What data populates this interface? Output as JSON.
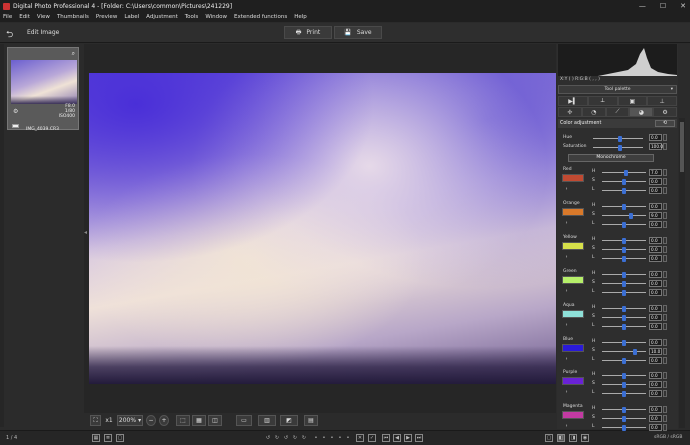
{
  "window": {
    "title": "Digital Photo Professional 4 - [Folder: C:\\Users\\common\\Pictures\\241229]",
    "min": "—",
    "max": "☐",
    "close": "✕"
  },
  "menu": [
    "File",
    "Edit",
    "View",
    "Thumbnails",
    "Preview",
    "Label",
    "Adjustment",
    "Tools",
    "Window",
    "Extended functions",
    "Help"
  ],
  "toolbar": {
    "edit_label": "Edit Image",
    "print_label": "Print",
    "save_label": "Save"
  },
  "thumbnail": {
    "exposure": "F8.0",
    "shutter": "1/80",
    "iso": "ISO400",
    "name": "IMG_4039.CR3"
  },
  "viewer": {
    "zoom": "200%",
    "fit": "x1"
  },
  "status": {
    "page": "1 / 4",
    "colorspace": "sRGB / sRGB"
  },
  "panel": {
    "rgb_line": "X:Y (     )   R:G:B (     ,     ,     )",
    "tool_palette": "Tool palette",
    "color_adjustment": "Color adjustment",
    "monochrome": "Monochrome"
  },
  "color_adjust": {
    "hue_label": "Hue",
    "hue_value": "0.0",
    "saturation_label": "Saturation",
    "saturation_value": "100.0"
  },
  "groups": [
    {
      "name": "Red",
      "color": "#c04a32",
      "h": "7.0",
      "s": "0.0",
      "l": "0.0"
    },
    {
      "name": "Orange",
      "color": "#d9792a",
      "h": "0.0",
      "s": "9.0",
      "l": "0.0"
    },
    {
      "name": "Yellow",
      "color": "#d6e04a",
      "h": "0.0",
      "s": "0.0",
      "l": "0.0"
    },
    {
      "name": "Green",
      "color": "#b6ef6a",
      "h": "0.0",
      "s": "0.0",
      "l": "0.0"
    },
    {
      "name": "Aqua",
      "color": "#8ee0d8",
      "h": "0.0",
      "s": "0.0",
      "l": "0.0"
    },
    {
      "name": "Blue",
      "color": "#2a1ad8",
      "h": "0.0",
      "s": "10.0",
      "l": "0.0"
    },
    {
      "name": "Purple",
      "color": "#6a22d6",
      "h": "0.0",
      "s": "0.0",
      "l": "0.0"
    },
    {
      "name": "Magenta",
      "color": "#c23aa2",
      "h": "0.0",
      "s": "0.0",
      "l": "0.0"
    }
  ],
  "hsl_labels": {
    "h": "H",
    "s": "S",
    "l": "L"
  }
}
